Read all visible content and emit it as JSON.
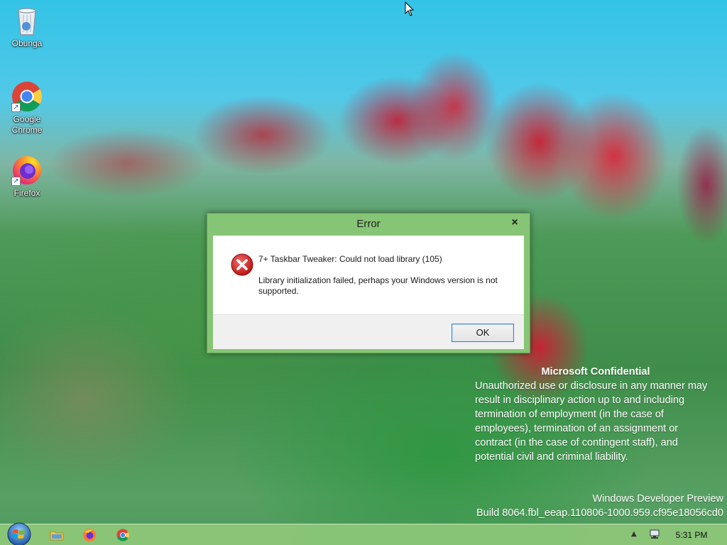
{
  "desktop": {
    "icons": [
      {
        "label": "Obunga",
        "icon": "recycle-bin-icon"
      },
      {
        "label": "Google Chrome",
        "icon": "chrome-icon"
      },
      {
        "label": "Firefox",
        "icon": "firefox-icon"
      }
    ]
  },
  "dialog": {
    "title": "Error",
    "close_glyph": "×",
    "message_title": "7+ Taskbar Tweaker: Could not load library (105)",
    "message_text": "Library initialization failed, perhaps your Windows version is not supported.",
    "ok_label": "OK",
    "icon": "error-icon"
  },
  "watermark": {
    "title": "Microsoft Confidential",
    "text": "Unauthorized use or disclosure in any manner may result in disciplinary action up to and including termination of employment (in the case of employees), termination of an assignment or contract (in the case of contingent staff), and potential civil and criminal liability.",
    "edition": "Windows Developer Preview",
    "build": "Build 8064.fbl_eeap.110806-1000.959.cf95e18056cd0"
  },
  "taskbar": {
    "start_icon": "windows-orb-icon",
    "pinned": [
      "file-explorer-icon",
      "firefox-icon",
      "chrome-icon"
    ],
    "tray_icons": [
      "show-hidden-icons-chevron-icon",
      "network-icon"
    ],
    "clock": "5:31 PM"
  }
}
